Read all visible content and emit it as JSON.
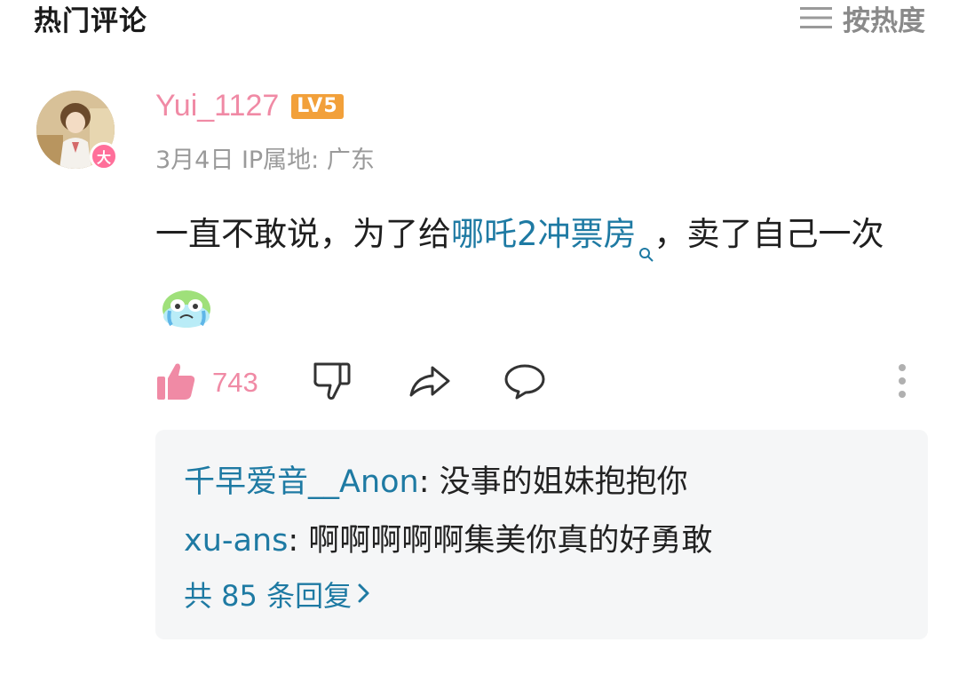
{
  "header": {
    "title": "热门评论",
    "sort_label": "按热度"
  },
  "comment": {
    "username": "Yui_1127",
    "level": "LV5",
    "avatar_badge": "大",
    "meta": "3月4日 IP属地: 广东",
    "text_before": "一直不敢说，为了给",
    "topic": "哪吒2冲票房",
    "text_after": "，卖了自己一次",
    "emoji": "crying-face-emoji",
    "likes": "743"
  },
  "replies": {
    "items": [
      {
        "user": "千早爱音__Anon",
        "separator": ": ",
        "text": "没事的姐妹抱抱你"
      },
      {
        "user": "xu-ans",
        "separator": ": ",
        "text": "啊啊啊啊啊集美你真的好勇敢"
      }
    ],
    "more_label": "共 85 条回复"
  },
  "colors": {
    "username": "#f08aa5",
    "link": "#1e7aa3",
    "level_badge": "#f2a03a",
    "like_active": "#f08aa5",
    "reply_bg": "#f5f6f7"
  }
}
